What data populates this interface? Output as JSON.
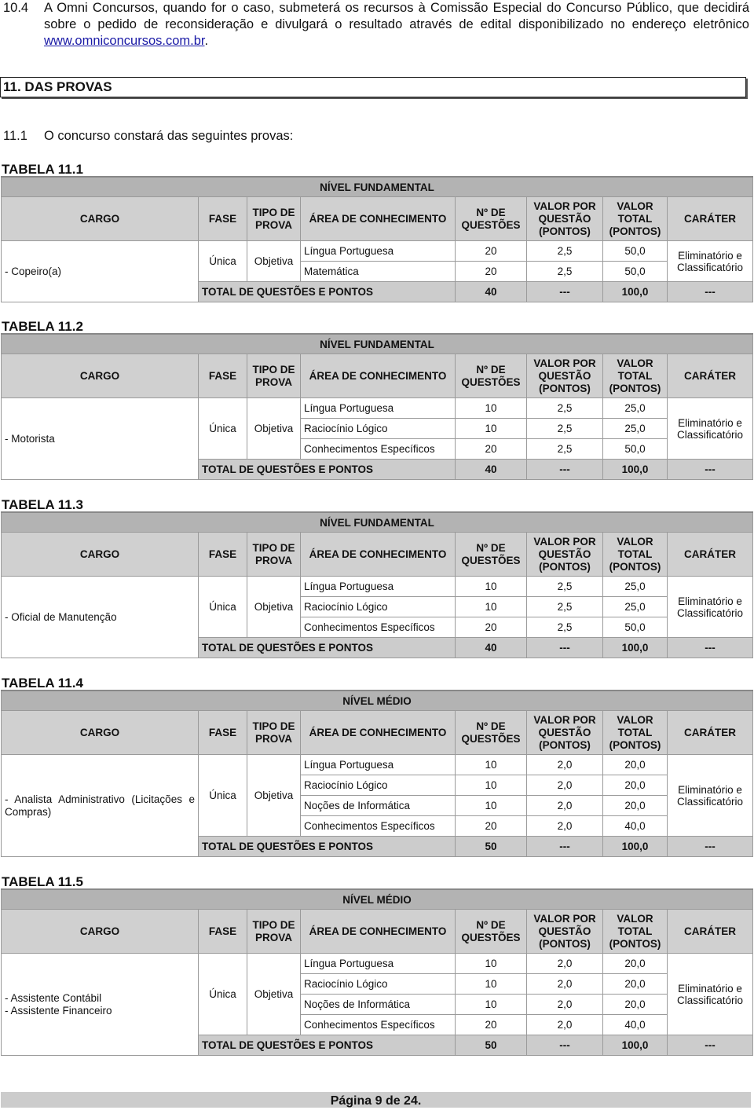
{
  "paragraph_10_4": {
    "number": "10.4",
    "text": "A Omni Concursos, quando for o caso, submeterá os recursos à Comissão Especial do Concurso Público, que decidirá sobre o pedido de reconsideração e divulgará o resultado através de edital disponibilizado no endereço eletrônico ",
    "link": "www.omniconcursos.com.br",
    "suffix": "."
  },
  "section": {
    "title": "11.  DAS PROVAS"
  },
  "intro": {
    "number": "11.1",
    "text": "O concurso constará das seguintes provas:"
  },
  "headers": {
    "cargo": "CARGO",
    "fase": "FASE",
    "tipo": "TIPO DE PROVA",
    "area": "ÁREA DE CONHECIMENTO",
    "num": "Nº DE QUESTÕES",
    "valor_por": "VALOR POR QUESTÃO (PONTOS)",
    "valor_total": "VALOR TOTAL (PONTOS)",
    "carater": "CARÁTER"
  },
  "total_label": "TOTAL DE QUESTÕES E PONTOS",
  "tables": [
    {
      "title": "TABELA 11.1",
      "level": "NÍVEL FUNDAMENTAL",
      "cargo": "- Copeiro(a)",
      "fase": "Única",
      "tipo": "Objetiva",
      "carater": "Eliminatório e Classificatório",
      "rows": [
        {
          "area": "Língua Portuguesa",
          "num": "20",
          "valor_por": "2,5",
          "valor_total": "50,0"
        },
        {
          "area": "Matemática",
          "num": "20",
          "valor_por": "2,5",
          "valor_total": "50,0"
        }
      ],
      "total": {
        "num": "40",
        "valor_por": "---",
        "valor_total": "100,0",
        "carater": "---"
      }
    },
    {
      "title": "TABELA 11.2",
      "level": "NÍVEL FUNDAMENTAL",
      "cargo": "- Motorista",
      "fase": "Única",
      "tipo": "Objetiva",
      "carater": "Eliminatório e Classificatório",
      "rows": [
        {
          "area": "Língua Portuguesa",
          "num": "10",
          "valor_por": "2,5",
          "valor_total": "25,0"
        },
        {
          "area": "Raciocínio Lógico",
          "num": "10",
          "valor_por": "2,5",
          "valor_total": "25,0"
        },
        {
          "area": "Conhecimentos Específicos",
          "num": "20",
          "valor_por": "2,5",
          "valor_total": "50,0"
        }
      ],
      "total": {
        "num": "40",
        "valor_por": "---",
        "valor_total": "100,0",
        "carater": "---"
      }
    },
    {
      "title": "TABELA 11.3",
      "level": "NÍVEL FUNDAMENTAL",
      "cargo": "- Oficial de Manutenção",
      "fase": "Única",
      "tipo": "Objetiva",
      "carater": "Eliminatório e Classificatório",
      "rows": [
        {
          "area": "Língua Portuguesa",
          "num": "10",
          "valor_por": "2,5",
          "valor_total": "25,0"
        },
        {
          "area": "Raciocínio Lógico",
          "num": "10",
          "valor_por": "2,5",
          "valor_total": "25,0"
        },
        {
          "area": "Conhecimentos Específicos",
          "num": "20",
          "valor_por": "2,5",
          "valor_total": "50,0"
        }
      ],
      "total": {
        "num": "40",
        "valor_por": "---",
        "valor_total": "100,0",
        "carater": "---"
      }
    },
    {
      "title": "TABELA 11.4",
      "level": "NÍVEL MÉDIO",
      "cargo": "- Analista Administrativo (Licitações e Compras)",
      "fase": "Única",
      "tipo": "Objetiva",
      "carater": "Eliminatório e Classificatório",
      "rows": [
        {
          "area": "Língua Portuguesa",
          "num": "10",
          "valor_por": "2,0",
          "valor_total": "20,0"
        },
        {
          "area": "Raciocínio Lógico",
          "num": "10",
          "valor_por": "2,0",
          "valor_total": "20,0"
        },
        {
          "area": "Noções de Informática",
          "num": "10",
          "valor_por": "2,0",
          "valor_total": "20,0"
        },
        {
          "area": "Conhecimentos Específicos",
          "num": "20",
          "valor_por": "2,0",
          "valor_total": "40,0"
        }
      ],
      "total": {
        "num": "50",
        "valor_por": "---",
        "valor_total": "100,0",
        "carater": "---"
      }
    },
    {
      "title": "TABELA 11.5",
      "level": "NÍVEL MÉDIO",
      "cargo": "- Assistente Contábil\n- Assistente Financeiro",
      "fase": "Única",
      "tipo": "Objetiva",
      "carater": "Eliminatório e Classificatório",
      "rows": [
        {
          "area": "Língua Portuguesa",
          "num": "10",
          "valor_por": "2,0",
          "valor_total": "20,0"
        },
        {
          "area": "Raciocínio Lógico",
          "num": "10",
          "valor_por": "2,0",
          "valor_total": "20,0"
        },
        {
          "area": "Noções de Informática",
          "num": "10",
          "valor_por": "2,0",
          "valor_total": "20,0"
        },
        {
          "area": "Conhecimentos Específicos",
          "num": "20",
          "valor_por": "2,0",
          "valor_total": "40,0"
        }
      ],
      "total": {
        "num": "50",
        "valor_por": "---",
        "valor_total": "100,0",
        "carater": "---"
      }
    }
  ],
  "footer": {
    "text": "Página 9 de 24."
  },
  "colors": {
    "level_bg": "#b3b3b3",
    "header_bg": "#d0d0d0",
    "total_bg": "#cccccc",
    "link": "#1a1aa6"
  }
}
